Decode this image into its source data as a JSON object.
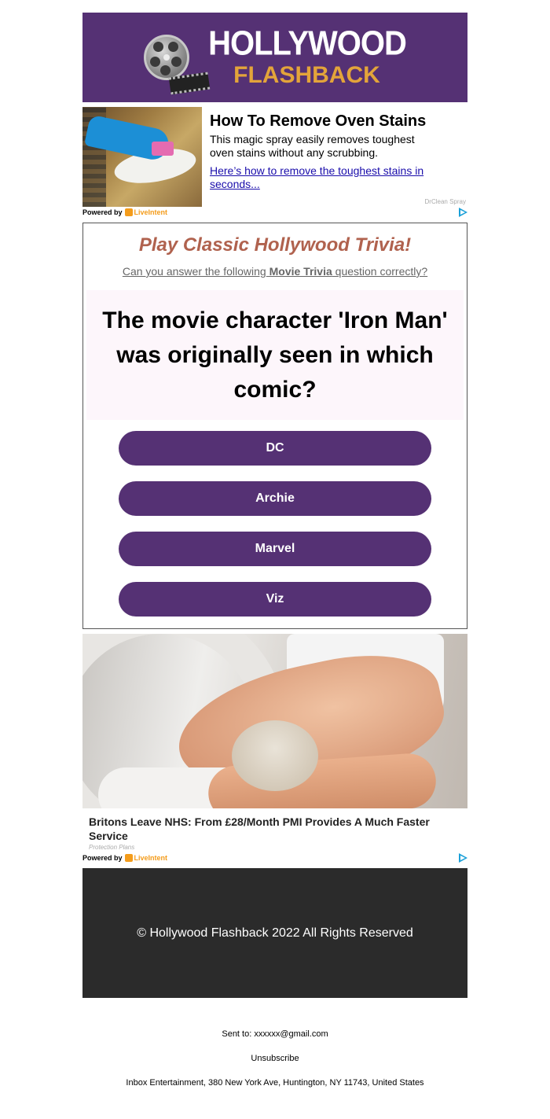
{
  "brand": {
    "logo_top": "HOLLYWOOD",
    "logo_bottom": "FLASHBACK",
    "purple": "#553174",
    "accent": "#e3a43a"
  },
  "ad_top": {
    "title": "How To Remove Oven Stains",
    "description": "This magic spray easily removes toughest oven stains without any scrubbing.",
    "link": "Here’s how to remove the toughest stains in seconds...",
    "sponsor": "DrClean Spray",
    "powered_by": "Powered by",
    "provider": "LiveIntent"
  },
  "trivia": {
    "heading": "Play Classic Hollywood Trivia!",
    "sub_prefix": "Can you answer the following",
    "sub_bold": " Movie Trivia",
    "sub_suffix": " question correctly?",
    "question": "The movie character 'Iron Man' was originally seen in which comic?",
    "answers": [
      "DC",
      "Archie",
      "Marvel",
      "Viz"
    ]
  },
  "ad_bottom": {
    "title": "Britons Leave NHS: From £28/Month PMI Provides A Much Faster Service",
    "source": "Protection Plans",
    "powered_by": "Powered by",
    "provider": "LiveIntent"
  },
  "footer": {
    "copyright": "© Hollywood Flashback 2022 All Rights Reserved",
    "sent_to": "Sent to: xxxxxx@gmail.com",
    "unsubscribe": "Unsubscribe",
    "address": "Inbox Entertainment, 380 New York Ave, Huntington, NY 11743, United States"
  }
}
